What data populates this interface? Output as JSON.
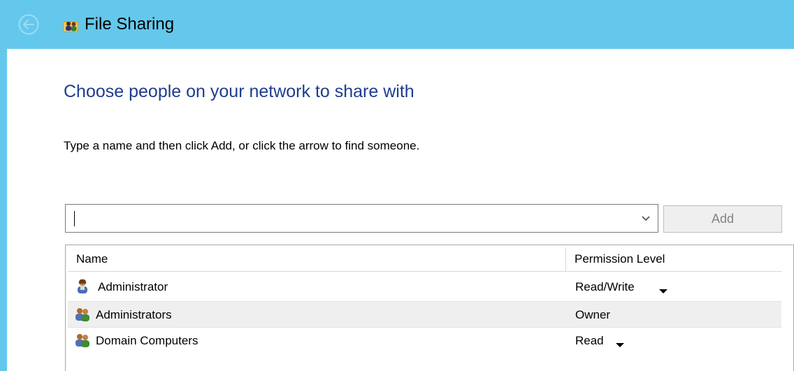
{
  "window": {
    "title": "File Sharing",
    "back_icon": "back-arrow-icon",
    "app_icon": "file-sharing-icon"
  },
  "main": {
    "heading": "Choose people on your network to share with",
    "instructions": "Type a name and then click Add, or click the arrow to find someone.",
    "name_input": {
      "value": "",
      "placeholder": ""
    },
    "add_label": "Add",
    "columns": {
      "name": "Name",
      "permission": "Permission Level"
    },
    "people": [
      {
        "name": "Administrator",
        "permission": "Read/Write",
        "icon": "single-user-icon",
        "has_dropdown": true
      },
      {
        "name": "Administrators",
        "permission": "Owner",
        "icon": "group-users-icon",
        "has_dropdown": false
      },
      {
        "name": "Domain Computers",
        "permission": "Read",
        "icon": "group-users-icon",
        "has_dropdown": true
      }
    ]
  },
  "colors": {
    "titlebar": "#64c8ec",
    "heading": "#1f3d8f",
    "selected_row": "#efefef",
    "disabled_text": "#838383"
  }
}
